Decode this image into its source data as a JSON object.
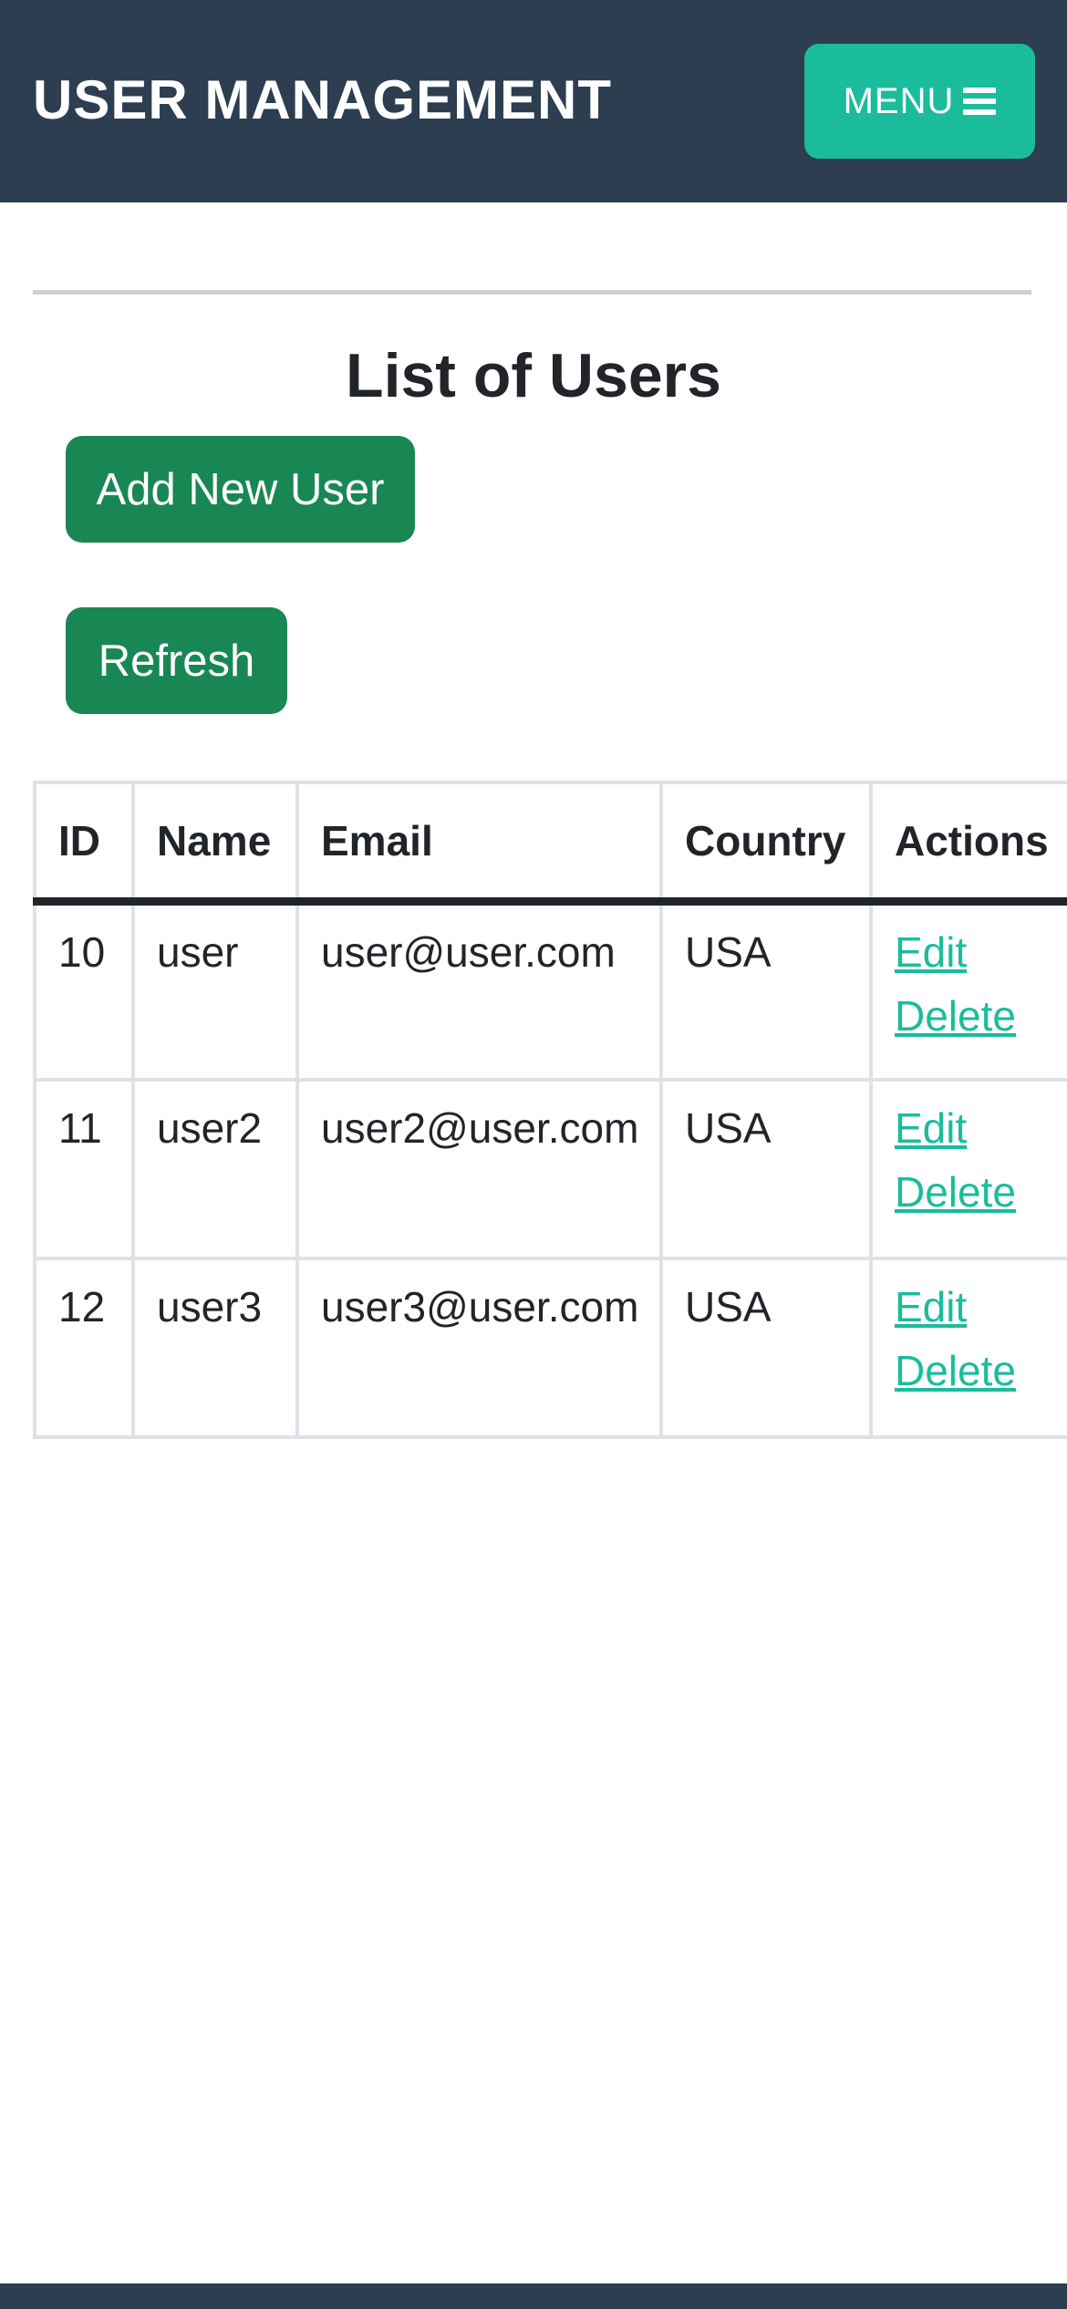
{
  "navbar": {
    "brand": "USER MANAGEMENT",
    "menu_label": "MENU",
    "menu_icon": "hamburger-icon",
    "background": "#2c3e50",
    "accent": "#1abc9c"
  },
  "main": {
    "title": "List of Users",
    "add_button_label": "Add New User",
    "refresh_button_label": "Refresh",
    "button_color": "#198754"
  },
  "table": {
    "headers": {
      "id": "ID",
      "name": "Name",
      "email": "Email",
      "country": "Country",
      "actions": "Actions"
    },
    "rows": [
      {
        "id": "10",
        "name": "user",
        "email": "user@user.com",
        "country": "USA",
        "edit": "Edit",
        "delete": "Delete"
      },
      {
        "id": "11",
        "name": "user2",
        "email": "user2@user.com",
        "country": "USA",
        "edit": "Edit",
        "delete": "Delete"
      },
      {
        "id": "12",
        "name": "user3",
        "email": "user3@user.com",
        "country": "USA",
        "edit": "Edit",
        "delete": "Delete"
      }
    ]
  }
}
